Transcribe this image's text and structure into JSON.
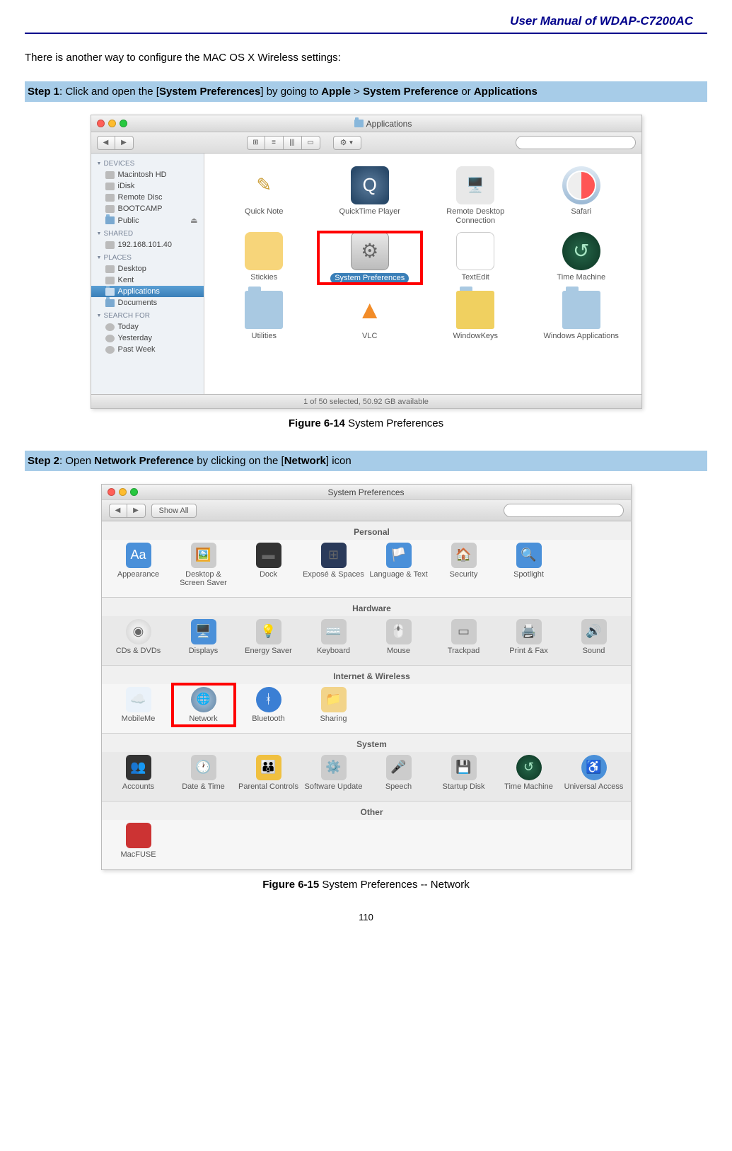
{
  "header": {
    "title": "User Manual of WDAP-C7200AC"
  },
  "intro": "There is another way to configure the MAC OS X Wireless settings:",
  "step1": {
    "label": "Step 1",
    "text_a": ": Click and open the [",
    "bold_a": "System Preferences",
    "text_b": "] by going to ",
    "bold_b": "Apple",
    "text_c": " > ",
    "bold_c": "System Preference",
    "text_d": " or ",
    "bold_d": "Applications"
  },
  "finder": {
    "title": "Applications",
    "search_placeholder": "",
    "status": "1 of 50 selected, 50.92 GB available",
    "sidebar": {
      "devices_head": "DEVICES",
      "devices": [
        "Macintosh HD",
        "iDisk",
        "Remote Disc",
        "BOOTCAMP",
        "Public"
      ],
      "shared_head": "SHARED",
      "shared": [
        "192.168.101.40"
      ],
      "places_head": "PLACES",
      "places": [
        "Desktop",
        "Kent",
        "Applications",
        "Documents"
      ],
      "search_head": "SEARCH FOR",
      "search": [
        "Today",
        "Yesterday",
        "Past Week"
      ]
    },
    "apps": [
      {
        "name": "Quick Note"
      },
      {
        "name": "QuickTime Player"
      },
      {
        "name": "Remote Desktop Connection"
      },
      {
        "name": "Safari"
      },
      {
        "name": "Stickies"
      },
      {
        "name": "System Preferences"
      },
      {
        "name": "TextEdit"
      },
      {
        "name": "Time Machine"
      },
      {
        "name": "Utilities"
      },
      {
        "name": "VLC"
      },
      {
        "name": "WindowKeys"
      },
      {
        "name": "Windows Applications"
      }
    ]
  },
  "caption1": {
    "bold": "Figure 6-14",
    "rest": " System Preferences"
  },
  "step2": {
    "label": "Step 2",
    "text_a": ": Open ",
    "bold_a": "Network Preference",
    "text_b": " by clicking on the [",
    "bold_b": "Network",
    "text_c": "] icon"
  },
  "prefs": {
    "title": "System Preferences",
    "show_all": "Show All",
    "search_placeholder": "",
    "sections": {
      "personal": {
        "label": "Personal",
        "items": [
          "Appearance",
          "Desktop & Screen Saver",
          "Dock",
          "Exposé & Spaces",
          "Language & Text",
          "Security",
          "Spotlight"
        ]
      },
      "hardware": {
        "label": "Hardware",
        "items": [
          "CDs & DVDs",
          "Displays",
          "Energy Saver",
          "Keyboard",
          "Mouse",
          "Trackpad",
          "Print & Fax",
          "Sound"
        ]
      },
      "internet": {
        "label": "Internet & Wireless",
        "items": [
          "MobileMe",
          "Network",
          "Bluetooth",
          "Sharing"
        ]
      },
      "system": {
        "label": "System",
        "items": [
          "Accounts",
          "Date & Time",
          "Parental Controls",
          "Software Update",
          "Speech",
          "Startup Disk",
          "Time Machine",
          "Universal Access"
        ]
      },
      "other": {
        "label": "Other",
        "items": [
          "MacFUSE"
        ]
      }
    }
  },
  "caption2": {
    "bold": "Figure 6-15",
    "rest": " System Preferences -- Network"
  },
  "page_number": "110"
}
